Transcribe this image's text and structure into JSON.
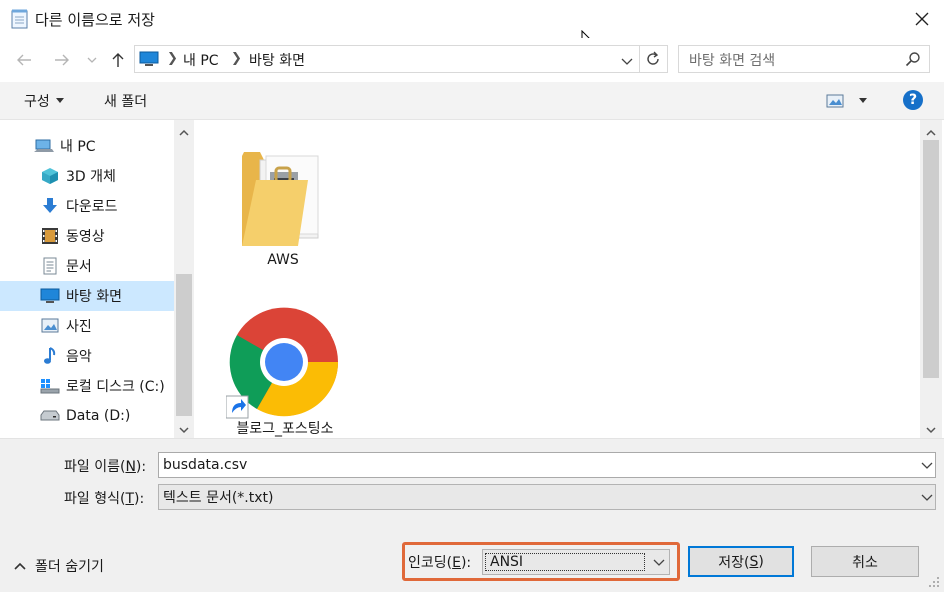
{
  "window": {
    "title": "다른 이름으로 저장"
  },
  "address": {
    "segments": [
      "내 PC",
      "바탕 화면"
    ]
  },
  "search": {
    "placeholder": "바탕 화면 검색"
  },
  "toolbar": {
    "organize": "구성",
    "new_folder": "새 폴더"
  },
  "nav": {
    "items": [
      {
        "label": "내 PC",
        "icon": "computer-icon"
      },
      {
        "label": "3D 개체",
        "icon": "cube-3d-icon"
      },
      {
        "label": "다운로드",
        "icon": "download-arrow-icon"
      },
      {
        "label": "동영상",
        "icon": "film-icon"
      },
      {
        "label": "문서",
        "icon": "document-icon"
      },
      {
        "label": "바탕 화면",
        "icon": "desktop-icon",
        "selected": true
      },
      {
        "label": "사진",
        "icon": "picture-icon"
      },
      {
        "label": "음악",
        "icon": "music-note-icon"
      },
      {
        "label": "로컬 디스크 (C:)",
        "icon": "windows-drive-icon"
      },
      {
        "label": "Data (D:)",
        "icon": "drive-icon"
      }
    ]
  },
  "files": [
    {
      "name": "AWS",
      "icon": "folder-icon"
    },
    {
      "name": "블로그_포스팅소",
      "icon": "chrome-shortcut-icon"
    }
  ],
  "form": {
    "filename_label_pre": "파일 이름(",
    "filename_label_key": "N",
    "filename_label_post": "):",
    "filename_value": "busdata.csv",
    "filetype_label_pre": "파일 형식(",
    "filetype_label_key": "T",
    "filetype_label_post": "):",
    "filetype_value": "텍스트 문서(*.txt)",
    "hide_folders": "폴더 숨기기",
    "encoding_label_pre": "인코딩(",
    "encoding_label_key": "E",
    "encoding_label_post": "):",
    "encoding_value": "ANSI",
    "save_pre": "저장(",
    "save_key": "S",
    "save_post": ")",
    "cancel": "취소"
  },
  "colors": {
    "highlight_box": "#e0693a",
    "accent": "#0078d7",
    "help": "#1670c9"
  }
}
